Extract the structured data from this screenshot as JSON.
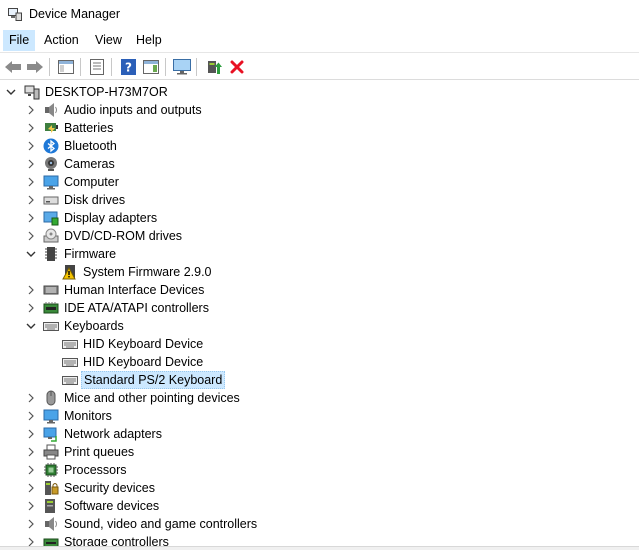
{
  "window": {
    "title": "Device Manager"
  },
  "menu": [
    "File",
    "Action",
    "View",
    "Help"
  ],
  "toolbar": {
    "buttons": [
      "back",
      "forward",
      "show-hide-console-tree",
      "properties",
      "help",
      "action-pane",
      "update-driver",
      "uninstall"
    ]
  },
  "tree": {
    "root": "DESKTOP-H73M7OR",
    "nodes": [
      {
        "label": "Audio inputs and outputs",
        "icon": "speaker-icon",
        "expanded": false,
        "level": 1
      },
      {
        "label": "Batteries",
        "icon": "battery-icon",
        "expanded": false,
        "level": 1
      },
      {
        "label": "Bluetooth",
        "icon": "bluetooth-icon",
        "expanded": false,
        "level": 1
      },
      {
        "label": "Cameras",
        "icon": "camera-icon",
        "expanded": false,
        "level": 1
      },
      {
        "label": "Computer",
        "icon": "computer-icon",
        "expanded": false,
        "level": 1
      },
      {
        "label": "Disk drives",
        "icon": "disk-drive-icon",
        "expanded": false,
        "level": 1
      },
      {
        "label": "Display adapters",
        "icon": "display-adapter-icon",
        "expanded": false,
        "level": 1
      },
      {
        "label": "DVD/CD-ROM drives",
        "icon": "dvd-icon",
        "expanded": false,
        "level": 1
      },
      {
        "label": "Firmware",
        "icon": "firmware-icon",
        "expanded": true,
        "level": 1
      },
      {
        "label": "System Firmware 2.9.0",
        "icon": "warning-icon",
        "level": 2
      },
      {
        "label": "Human Interface Devices",
        "icon": "hid-icon",
        "expanded": false,
        "level": 1
      },
      {
        "label": "IDE ATA/ATAPI controllers",
        "icon": "ide-icon",
        "expanded": false,
        "level": 1
      },
      {
        "label": "Keyboards",
        "icon": "keyboard-icon",
        "expanded": true,
        "level": 1
      },
      {
        "label": "HID Keyboard Device",
        "icon": "keyboard-icon",
        "level": 2
      },
      {
        "label": "HID Keyboard Device",
        "icon": "keyboard-icon",
        "level": 2
      },
      {
        "label": "Standard PS/2 Keyboard",
        "icon": "keyboard-icon",
        "level": 2,
        "selected": true
      },
      {
        "label": "Mice and other pointing devices",
        "icon": "mouse-icon",
        "expanded": false,
        "level": 1
      },
      {
        "label": "Monitors",
        "icon": "monitor-icon",
        "expanded": false,
        "level": 1
      },
      {
        "label": "Network adapters",
        "icon": "network-icon",
        "expanded": false,
        "level": 1
      },
      {
        "label": "Print queues",
        "icon": "printer-icon",
        "expanded": false,
        "level": 1
      },
      {
        "label": "Processors",
        "icon": "processor-icon",
        "expanded": false,
        "level": 1
      },
      {
        "label": "Security devices",
        "icon": "security-icon",
        "expanded": false,
        "level": 1
      },
      {
        "label": "Software devices",
        "icon": "software-icon",
        "expanded": false,
        "level": 1
      },
      {
        "label": "Sound, video and game controllers",
        "icon": "sound-icon",
        "expanded": false,
        "level": 1
      },
      {
        "label": "Storage controllers",
        "icon": "storage-icon",
        "expanded": false,
        "level": 1
      }
    ]
  },
  "colors": {
    "selection": "#cce8ff",
    "menu_active": "#cce8ff",
    "uninstall_red": "#e81123"
  }
}
